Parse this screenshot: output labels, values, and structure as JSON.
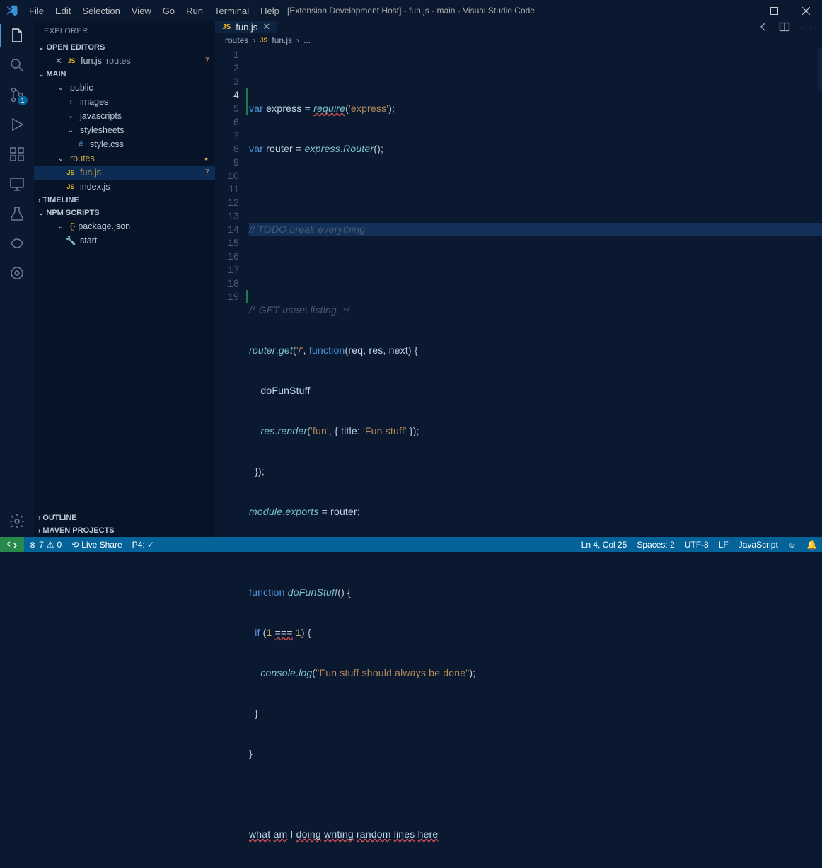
{
  "window": {
    "title": "[Extension Development Host] - fun.js - main - Visual Studio Code",
    "menu": [
      "File",
      "Edit",
      "Selection",
      "View",
      "Go",
      "Run",
      "Terminal",
      "Help"
    ]
  },
  "activity": {
    "scm_badge": "1"
  },
  "explorer": {
    "title": "EXPLORER",
    "sections": {
      "open_editors": "OPEN EDITORS",
      "main": "MAIN",
      "timeline": "TIMELINE",
      "npm": "NPM SCRIPTS",
      "outline": "OUTLINE",
      "maven": "MAVEN PROJECTS"
    },
    "open_editor": {
      "label": "fun.js",
      "path": "routes",
      "problems": "7"
    },
    "tree": {
      "public": "public",
      "images": "images",
      "javascripts": "javascripts",
      "stylesheets": "stylesheets",
      "stylecss": "style.css",
      "routes": "routes",
      "funjs": "fun.js",
      "funjs_problems": "7",
      "indexjs": "index.js",
      "packagejson": "package.json",
      "start": "start"
    }
  },
  "tab": {
    "label": "fun.js"
  },
  "breadcrumbs": {
    "a": "routes",
    "b": "fun.js",
    "c": "..."
  },
  "code": {
    "l1": {
      "a": "var",
      "b": " express ",
      "c": "=",
      "d": " ",
      "e": "require",
      "f": "(",
      "g": "'express'",
      "h": ");"
    },
    "l2": {
      "a": "var",
      "b": " router ",
      "c": "=",
      "d": " ",
      "e": "express",
      "f": ".",
      "g": "Router",
      "h": "();"
    },
    "l4": "// TODO break everything",
    "l6": "/* GET users listing. */",
    "l7": {
      "a": "router",
      "b": ".",
      "c": "get",
      "d": "(",
      "e": "'/'",
      "f": ", ",
      "g": "function",
      "h": "(",
      "i": "req",
      "j": ", ",
      "k": "res",
      "l": ", ",
      "m": "next",
      "n": ") {"
    },
    "l8": {
      "a": "    ",
      "b": "doFunStuff"
    },
    "l9": {
      "a": "    ",
      "b": "res",
      "c": ".",
      "d": "render",
      "e": "(",
      "f": "'fun'",
      "g": ", { ",
      "h": "title",
      "i": ": ",
      "j": "'Fun stuff'",
      "k": " });"
    },
    "l10": "  });",
    "l11": {
      "a": "module",
      "b": ".",
      "c": "exports",
      "d": " = ",
      "e": "router",
      "f": ";"
    },
    "l13": {
      "a": "function",
      "b": " ",
      "c": "doFunStuff",
      "d": "() {"
    },
    "l14": {
      "a": "  ",
      "b": "if",
      "c": " (",
      "d": "1",
      "e": " ",
      "f": "===",
      "g": " ",
      "h": "1",
      "i": ") {"
    },
    "l15": {
      "a": "    ",
      "b": "console",
      "c": ".",
      "d": "log",
      "e": "(",
      "f": "\"Fun stuff should always be done\"",
      "g": ");"
    },
    "l16": "  }",
    "l17": "}",
    "l19": {
      "a": "what",
      "b": " ",
      "c": "am",
      "d": " ",
      "e": "I",
      "f": " ",
      "g": "doing",
      "h": " ",
      "i": "writing",
      "j": " ",
      "k": "random",
      "l": " ",
      "m": "lines",
      "n": " ",
      "o": "here"
    }
  },
  "status": {
    "errors": "7",
    "warnings": "0",
    "liveshare": "Live Share",
    "p4": "P4: ✓",
    "cursor": "Ln 4, Col 25",
    "spaces": "Spaces: 2",
    "encoding": "UTF-8",
    "eol": "LF",
    "lang": "JavaScript"
  }
}
